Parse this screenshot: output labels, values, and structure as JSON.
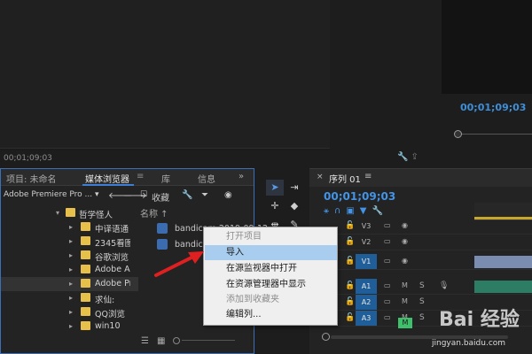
{
  "source_monitor": {
    "timecode": "00;01;09;03",
    "controls": [
      "wrench-icon",
      "export-frame-icon"
    ]
  },
  "program_monitor": {
    "timecode": "00;01;09;03"
  },
  "media_panel": {
    "tabs": [
      {
        "label": "项目: 未命名"
      },
      {
        "label": "媒体浏览器"
      },
      {
        "label": "库"
      },
      {
        "label": "信息"
      }
    ],
    "menu_icon": "≡",
    "more_icon": "»",
    "source_select": "Adobe Premiere Pro ...",
    "favorites_label": "收藏",
    "tree": [
      {
        "label": "哲学怪人"
      },
      {
        "label": "中译语通"
      },
      {
        "label": "2345看图"
      },
      {
        "label": "谷歌浏览"
      },
      {
        "label": "Adobe Ac"
      },
      {
        "label": "Adobe Pr"
      },
      {
        "label": "求仙:"
      },
      {
        "label": "QQ浏览"
      },
      {
        "label": "win10"
      }
    ],
    "files_header": "名称 ↑",
    "files": [
      {
        "label": "bandicam 2019-09-12"
      },
      {
        "label": "bandicam"
      }
    ]
  },
  "sequence": {
    "tab_label": "序列 01",
    "timecode": "00;01;09;03",
    "tracks": [
      {
        "name": "V3"
      },
      {
        "name": "V2"
      },
      {
        "name": "V1"
      },
      {
        "name": "A1",
        "m": "M",
        "s": "S"
      },
      {
        "name": "A2",
        "m": "M",
        "s": "S"
      },
      {
        "name": "A3",
        "m": "M",
        "s": "S"
      }
    ],
    "master_label": "M"
  },
  "context_menu": {
    "items": [
      {
        "label": "打开项目",
        "disabled": true
      },
      {
        "label": "导入",
        "highlight": true
      },
      {
        "label": "在源监视器中打开"
      },
      {
        "label": "在资源管理器中显示"
      },
      {
        "label": "添加到收藏夹",
        "disabled": true
      },
      {
        "label": "编辑列..."
      }
    ]
  },
  "watermark": {
    "brand": "Bai 经验",
    "url": "jingyan.baidu.com"
  },
  "colors": {
    "accent": "#3d7fd6",
    "timecode": "#4394e6",
    "arrow": "#e02020",
    "folder": "#e6c04a"
  }
}
